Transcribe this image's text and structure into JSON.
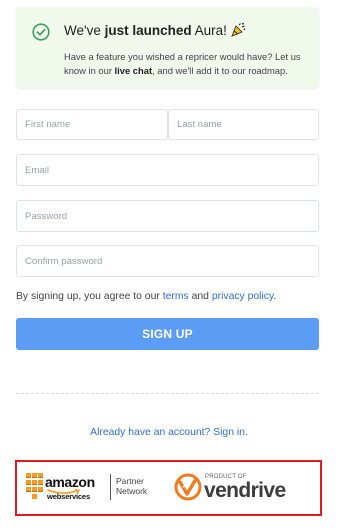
{
  "notice": {
    "title_prefix": "We've ",
    "title_bold": "just launched",
    "title_suffix": " Aura!",
    "body_prefix": "Have a feature you wished a repricer would have? Let us know in our ",
    "body_bold": "live chat",
    "body_suffix": ", and we'll add it to our roadmap."
  },
  "form": {
    "first_name_placeholder": "First name",
    "last_name_placeholder": "Last name",
    "email_placeholder": "Email",
    "password_placeholder": "Password",
    "confirm_password_placeholder": "Confirm password"
  },
  "terms": {
    "prefix": "By signing up, you agree to our ",
    "terms_link": "terms",
    "and": " and ",
    "privacy_link": "privacy policy",
    "suffix": "."
  },
  "signup_button": "SIGN UP",
  "signin_link": "Already have an account? Sign in.",
  "logos": {
    "amazon": "amazon",
    "web_services": "webservices",
    "partner_line1": "Partner",
    "partner_line2": "Network",
    "product_of": "PRODUCT OF",
    "vendrive": "vendrive"
  },
  "colors": {
    "notice_bg": "#f1f9ec",
    "check_green": "#3aa35a",
    "button_blue": "#5b9cf5",
    "link_blue": "#2f6fd6",
    "highlight_border": "#e11b22",
    "aws_orange": "#f79c1d",
    "vendrive_orange": "#f07c22"
  }
}
